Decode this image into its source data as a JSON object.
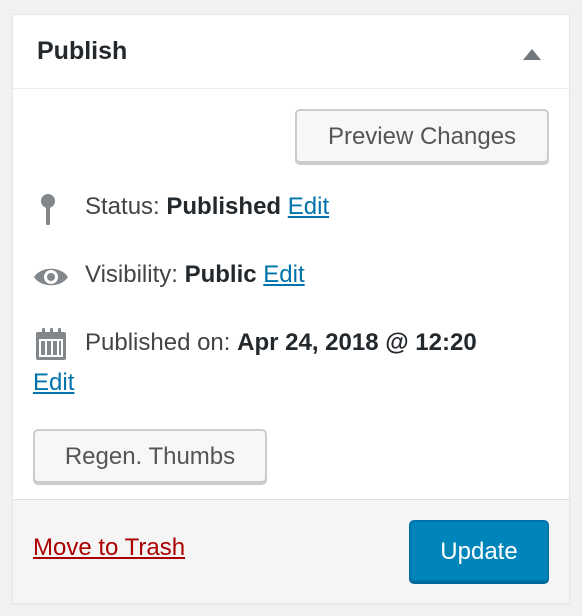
{
  "panel": {
    "title": "Publish"
  },
  "actions": {
    "preview_label": "Preview Changes",
    "regen_label": "Regen. Thumbs"
  },
  "status": {
    "label": "Status:",
    "value": "Published",
    "edit_label": "Edit"
  },
  "visibility": {
    "label": "Visibility:",
    "value": "Public",
    "edit_label": "Edit"
  },
  "published_on": {
    "label": "Published on:",
    "value": "Apr 24, 2018 @ 12:20",
    "edit_label": "Edit"
  },
  "footer": {
    "trash_label": "Move to Trash",
    "update_label": "Update"
  },
  "colors": {
    "link": "#0073aa",
    "trash": "#aa0000",
    "primary": "#0085ba",
    "icon": "#82878c"
  },
  "icons": {
    "status": "pin-icon",
    "visibility": "eye-icon",
    "published_on": "calendar-icon",
    "toggle": "triangle-up-icon"
  }
}
